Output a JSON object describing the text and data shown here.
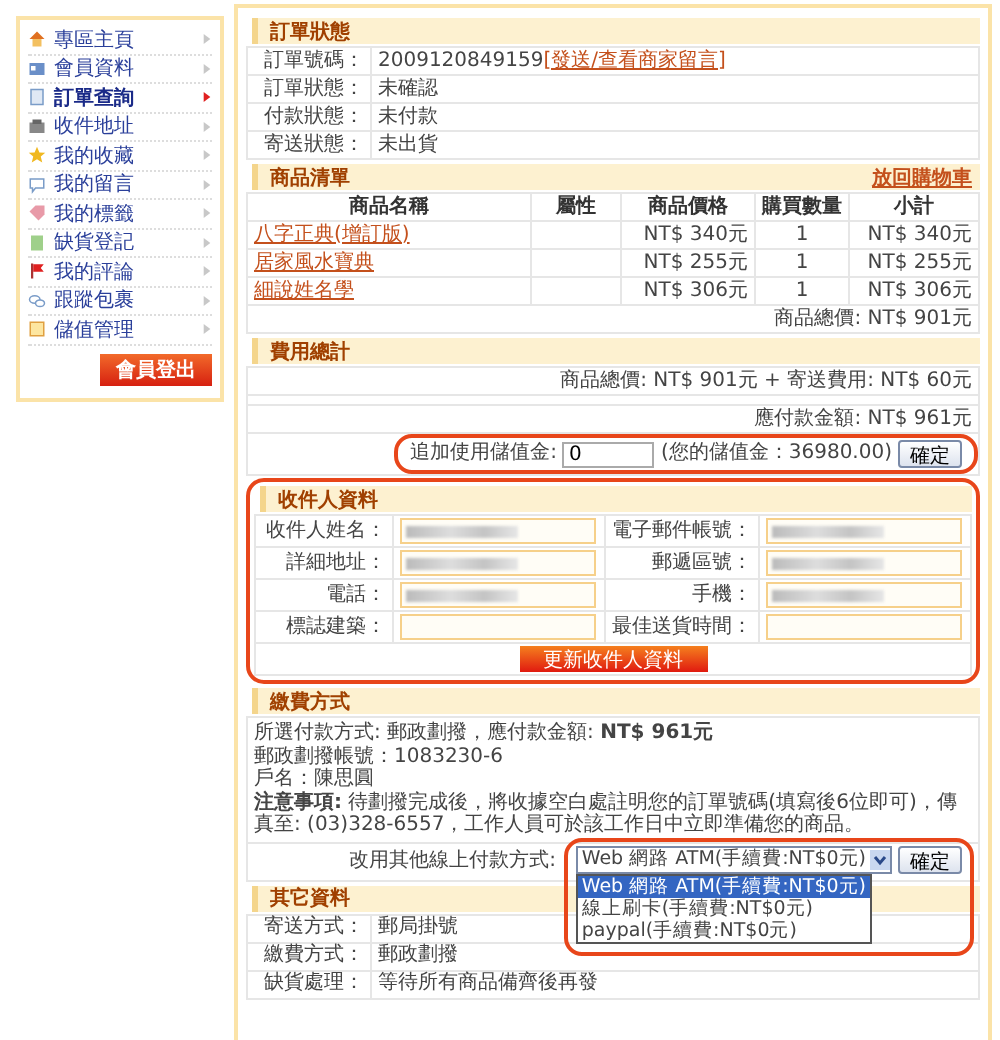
{
  "sidebar": {
    "items": [
      {
        "label": "專區主頁",
        "selected": false
      },
      {
        "label": "會員資料",
        "selected": false
      },
      {
        "label": "訂單查詢",
        "selected": true
      },
      {
        "label": "收件地址",
        "selected": false
      },
      {
        "label": "我的收藏",
        "selected": false
      },
      {
        "label": "我的留言",
        "selected": false
      },
      {
        "label": "我的標籤",
        "selected": false
      },
      {
        "label": "缺貨登記",
        "selected": false
      },
      {
        "label": "我的評論",
        "selected": false
      },
      {
        "label": "跟蹤包裹",
        "selected": false
      },
      {
        "label": "儲值管理",
        "selected": false
      }
    ],
    "logout_button": "會員登出"
  },
  "order_status": {
    "title": "訂單狀態",
    "rows": [
      {
        "label": "訂單號碼：",
        "value": "2009120849159",
        "link": "[發送/查看商家留言]"
      },
      {
        "label": "訂單狀態：",
        "value": "未確認"
      },
      {
        "label": "付款狀態：",
        "value": "未付款"
      },
      {
        "label": "寄送狀態：",
        "value": "未出貨"
      }
    ]
  },
  "products": {
    "title": "商品清單",
    "action": "放回購物車",
    "columns": [
      "商品名稱",
      "屬性",
      "商品價格",
      "購買數量",
      "小計"
    ],
    "rows": [
      {
        "name": "八字正典(增訂版)",
        "price": "NT$ 340元",
        "quantity": "1",
        "subtotal": "NT$ 340元"
      },
      {
        "name": "居家風水寶典",
        "price": "NT$ 255元",
        "quantity": "1",
        "subtotal": "NT$ 255元"
      },
      {
        "name": "細說姓名學",
        "price": "NT$ 306元",
        "quantity": "1",
        "subtotal": "NT$ 306元"
      }
    ],
    "total": "商品總價: NT$ 901元"
  },
  "fees": {
    "title": "費用總計",
    "summary": "商品總價: NT$ 901元 + 寄送費用: NT$ 60元",
    "amount_due": "應付款金額: NT$ 961元",
    "stored_value": {
      "label": "追加使用儲值金:",
      "value": "0",
      "balance": "(您的儲值金：36980.00)",
      "button": "確定"
    }
  },
  "recipient": {
    "title": "收件人資料",
    "fields": [
      {
        "label": "收件人姓名：",
        "redacted": true
      },
      {
        "label": "電子郵件帳號：",
        "redacted": true
      },
      {
        "label": "詳細地址：",
        "redacted": true
      },
      {
        "label": "郵遞區號：",
        "redacted": true
      },
      {
        "label": "電話：",
        "redacted": true
      },
      {
        "label": "手機：",
        "redacted": true
      },
      {
        "label": "標誌建築：",
        "redacted": false
      },
      {
        "label": "最佳送貨時間：",
        "redacted": false
      }
    ],
    "button": "更新收件人資料"
  },
  "payment": {
    "title": "繳費方式",
    "lines": [
      "所選付款方式: 郵政劃撥，應付款金額: **NT$ 961元**",
      "郵政劃撥帳號：1083230-6",
      "戶名：陳思圓",
      "**注意事項:** 待劃撥完成後，將收據空白處註明您的訂單號碼(填寫後6位即可)，傳真至: (03)328-6557，工作人員可於該工作日中立即準備您的商品。"
    ],
    "switch": {
      "label": "改用其他線上付款方式:",
      "value": "Web 網路 ATM(手續費:NT$0元)",
      "button": "確定",
      "options": [
        {
          "label": "Web 網路 ATM(手續費:NT$0元)",
          "selected": true
        },
        {
          "label": "線上刷卡(手續費:NT$0元)",
          "selected": false
        },
        {
          "label": "paypal(手續費:NT$0元)",
          "selected": false
        }
      ]
    }
  },
  "other": {
    "title": "其它資料",
    "rows": [
      {
        "label": "寄送方式：",
        "value": "郵局掛號"
      },
      {
        "label": "繳費方式：",
        "value": "郵政劃撥"
      },
      {
        "label": "缺貨處理：",
        "value": "等待所有商品備齊後再發"
      }
    ]
  }
}
